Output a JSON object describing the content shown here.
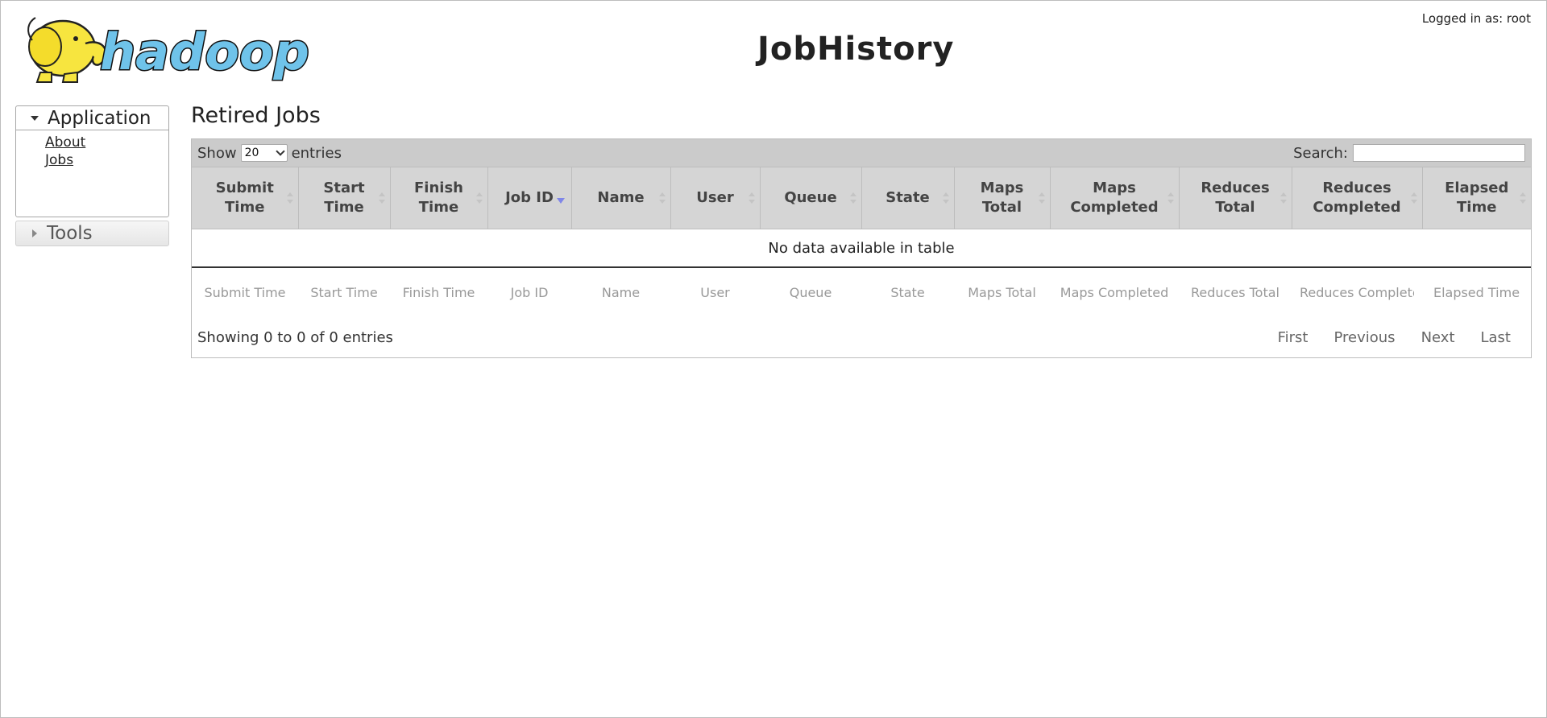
{
  "header": {
    "page_title": "JobHistory",
    "logged_in_text": "Logged in as: root",
    "logo_text": "hadoop"
  },
  "sidebar": {
    "application": {
      "label": "Application",
      "links": [
        "About",
        "Jobs"
      ]
    },
    "tools": {
      "label": "Tools"
    }
  },
  "main": {
    "section_title": "Retired Jobs",
    "length": {
      "show_label": "Show",
      "selected": "20",
      "entries_label": "entries"
    },
    "search": {
      "label": "Search:",
      "value": ""
    },
    "columns": [
      "Submit Time",
      "Start Time",
      "Finish Time",
      "Job ID",
      "Name",
      "User",
      "Queue",
      "State",
      "Maps Total",
      "Maps Completed",
      "Reduces Total",
      "Reduces Completed",
      "Elapsed Time"
    ],
    "sorted_column": "Job ID",
    "sorted_direction": "desc",
    "empty_message": "No data available in table",
    "footer_filters": [
      "Submit Time",
      "Start Time",
      "Finish Time",
      "Job ID",
      "Name",
      "User",
      "Queue",
      "State",
      "Maps Total",
      "Maps Completed",
      "Reduces Total",
      "Reduces Completed",
      "Elapsed Time"
    ],
    "info": "Showing 0 to 0 of 0 entries",
    "paging": {
      "first": "First",
      "previous": "Previous",
      "next": "Next",
      "last": "Last"
    }
  },
  "colors": {
    "header_bg": "#d5d5d5",
    "toolbar_bg": "#cbcbcb",
    "sort_active": "#7f86e8",
    "logo_yellow": "#f7e53f",
    "logo_blue": "#6fc3ea"
  }
}
